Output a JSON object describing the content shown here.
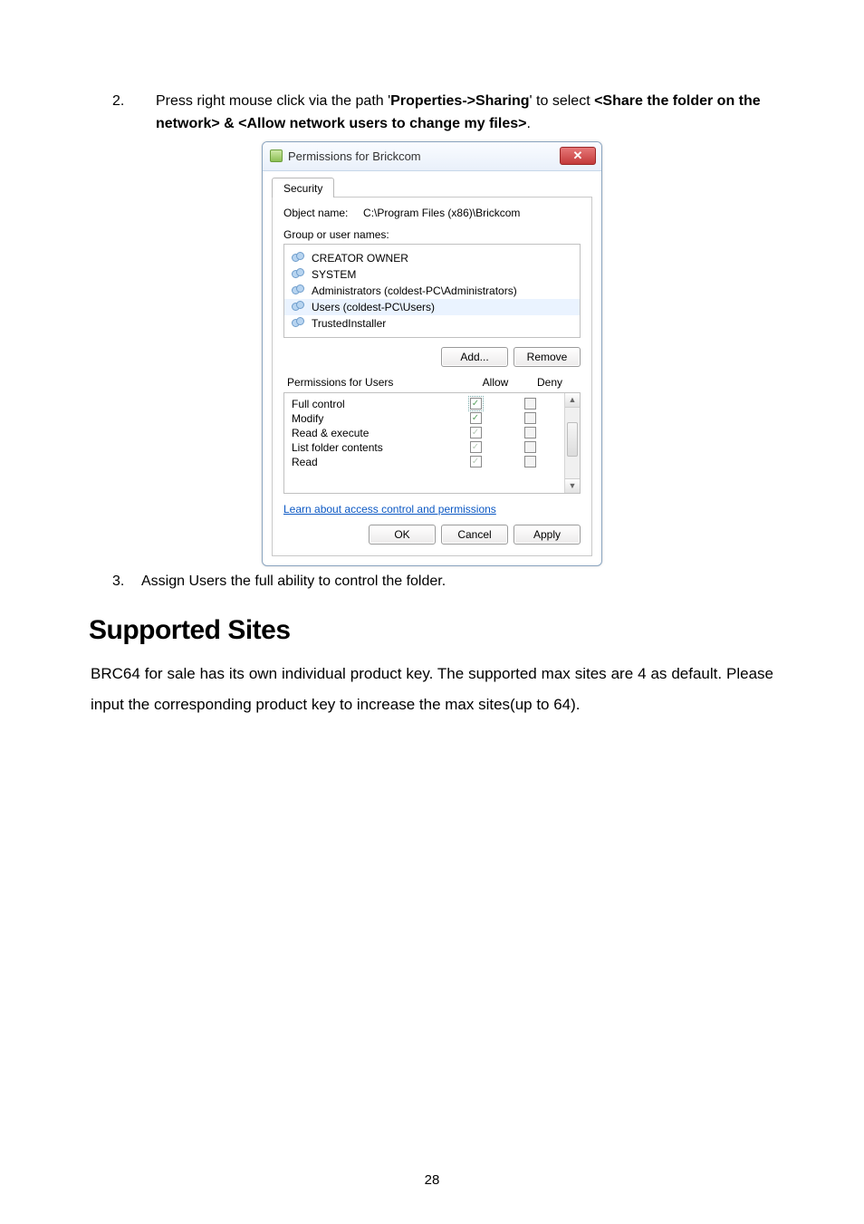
{
  "step2": {
    "num": "2.",
    "t1": "Press right mouse click via the path '",
    "b1": "Properties->Sharing",
    "t2": "' to select ",
    "b2": "<Share the folder on the network> & <Allow network users to change my files>",
    "t3": "."
  },
  "dialog": {
    "title": "Permissions for Brickcom",
    "close": "✕",
    "tab": "Security",
    "objectLabel": "Object name:",
    "objectValue": "C:\\Program Files (x86)\\Brickcom",
    "groupLabel": "Group or user names:",
    "groups": [
      "CREATOR OWNER",
      "SYSTEM",
      "Administrators (coldest-PC\\Administrators)",
      "Users (coldest-PC\\Users)",
      "TrustedInstaller"
    ],
    "addBtn": "Add...",
    "removeBtn": "Remove",
    "permHeader": "Permissions for Users",
    "allow": "Allow",
    "deny": "Deny",
    "perms": [
      {
        "name": "Full control",
        "allow": true,
        "enabled": true,
        "focused": true
      },
      {
        "name": "Modify",
        "allow": true,
        "enabled": true,
        "focused": false
      },
      {
        "name": "Read & execute",
        "allow": true,
        "enabled": false,
        "focused": false
      },
      {
        "name": "List folder contents",
        "allow": true,
        "enabled": false,
        "focused": false
      },
      {
        "name": "Read",
        "allow": true,
        "enabled": false,
        "focused": false
      }
    ],
    "link": "Learn about access control and permissions",
    "ok": "OK",
    "cancel": "Cancel",
    "apply": "Apply"
  },
  "step3": {
    "num": "3.",
    "txt": "Assign Users the full ability to control the folder."
  },
  "section": "Supported Sites",
  "paragraph": "BRC64 for sale has its own individual product key. The supported max sites are 4 as default. Please input the corresponding product key to increase the max sites(up to 64).",
  "pagenum": "28"
}
